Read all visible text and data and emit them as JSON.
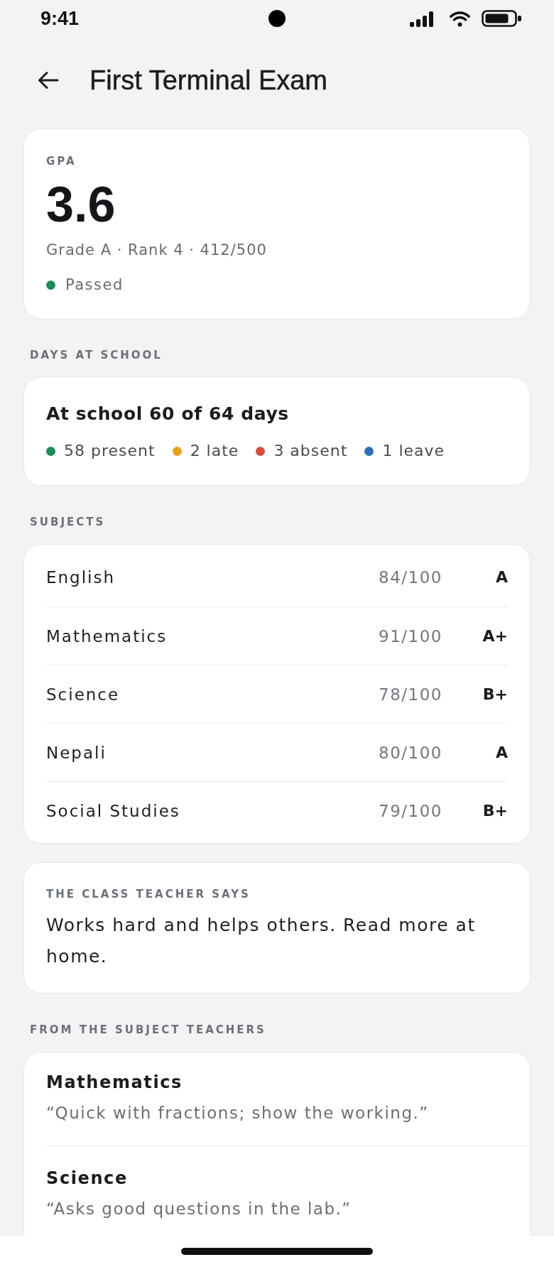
{
  "status_bar": {
    "time": "9:41"
  },
  "header": {
    "title": "First Terminal Exam"
  },
  "gpa": {
    "label": "GPA",
    "value": "3.6",
    "summary": "Grade A · Rank 4 · 412/500",
    "status": {
      "text": "Passed",
      "passed": true
    }
  },
  "attendance": {
    "heading": "DAYS AT SCHOOL",
    "title": "At school 60 of 64 days",
    "legend": [
      {
        "text": "58 present",
        "color": "#1e8c5a"
      },
      {
        "text": "2 late",
        "color": "#e3a11b"
      },
      {
        "text": "3 absent",
        "color": "#d44c3e"
      },
      {
        "text": "1 leave",
        "color": "#2f6cb8"
      }
    ]
  },
  "subjects": {
    "heading": "SUBJECTS",
    "rows": [
      {
        "name": "English",
        "score": "84/100",
        "grade": "A"
      },
      {
        "name": "Mathematics",
        "score": "91/100",
        "grade": "A+"
      },
      {
        "name": "Science",
        "score": "78/100",
        "grade": "B+"
      },
      {
        "name": "Nepali",
        "score": "80/100",
        "grade": "A"
      },
      {
        "name": "Social Studies",
        "score": "79/100",
        "grade": "B+"
      }
    ]
  },
  "class_teacher": {
    "label": "THE CLASS TEACHER SAYS",
    "comment": "Works hard and helps others. Read more at home."
  },
  "subject_teachers": {
    "heading": "FROM THE SUBJECT TEACHERS",
    "items": [
      {
        "subject": "Mathematics",
        "comment": "“Quick with fractions; show the working.”"
      },
      {
        "subject": "Science",
        "comment": "“Asks good questions in the lab.”"
      }
    ]
  }
}
